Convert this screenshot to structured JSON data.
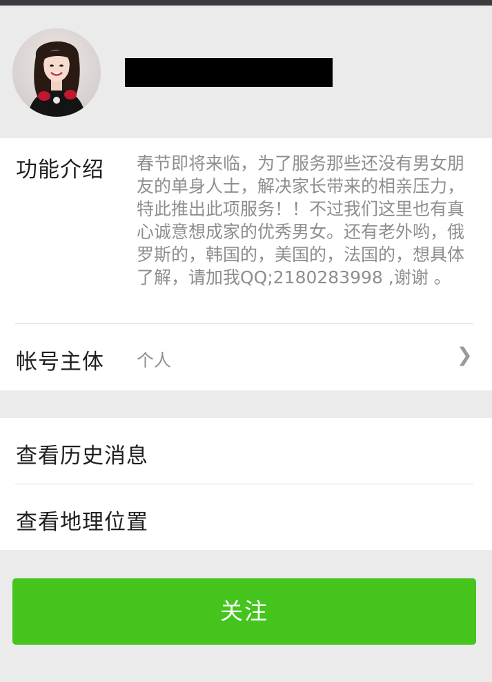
{
  "profile": {
    "avatar_alt": "",
    "name": ""
  },
  "intro": {
    "label": "功能介绍",
    "text": "春节即将来临，为了服务那些还没有男女朋友的单身人士，解决家长带来的相亲压力，特此推出此项服务！！不过我们这里也有真心诚意想成家的优秀男女。还有老外哟，俄罗斯的，韩国的，美国的，法国的，想具体了解，请加我QQ;2180283998 ,谢谢 。"
  },
  "account": {
    "label": "帐号主体",
    "value": "个人",
    "chevron": "❯"
  },
  "menu": {
    "history": "查看历史消息",
    "location": "查看地理位置"
  },
  "follow_button": "关注",
  "colors": {
    "accent": "#44c41c",
    "background": "#ebebeb",
    "topbar": "#3b3b3f"
  }
}
